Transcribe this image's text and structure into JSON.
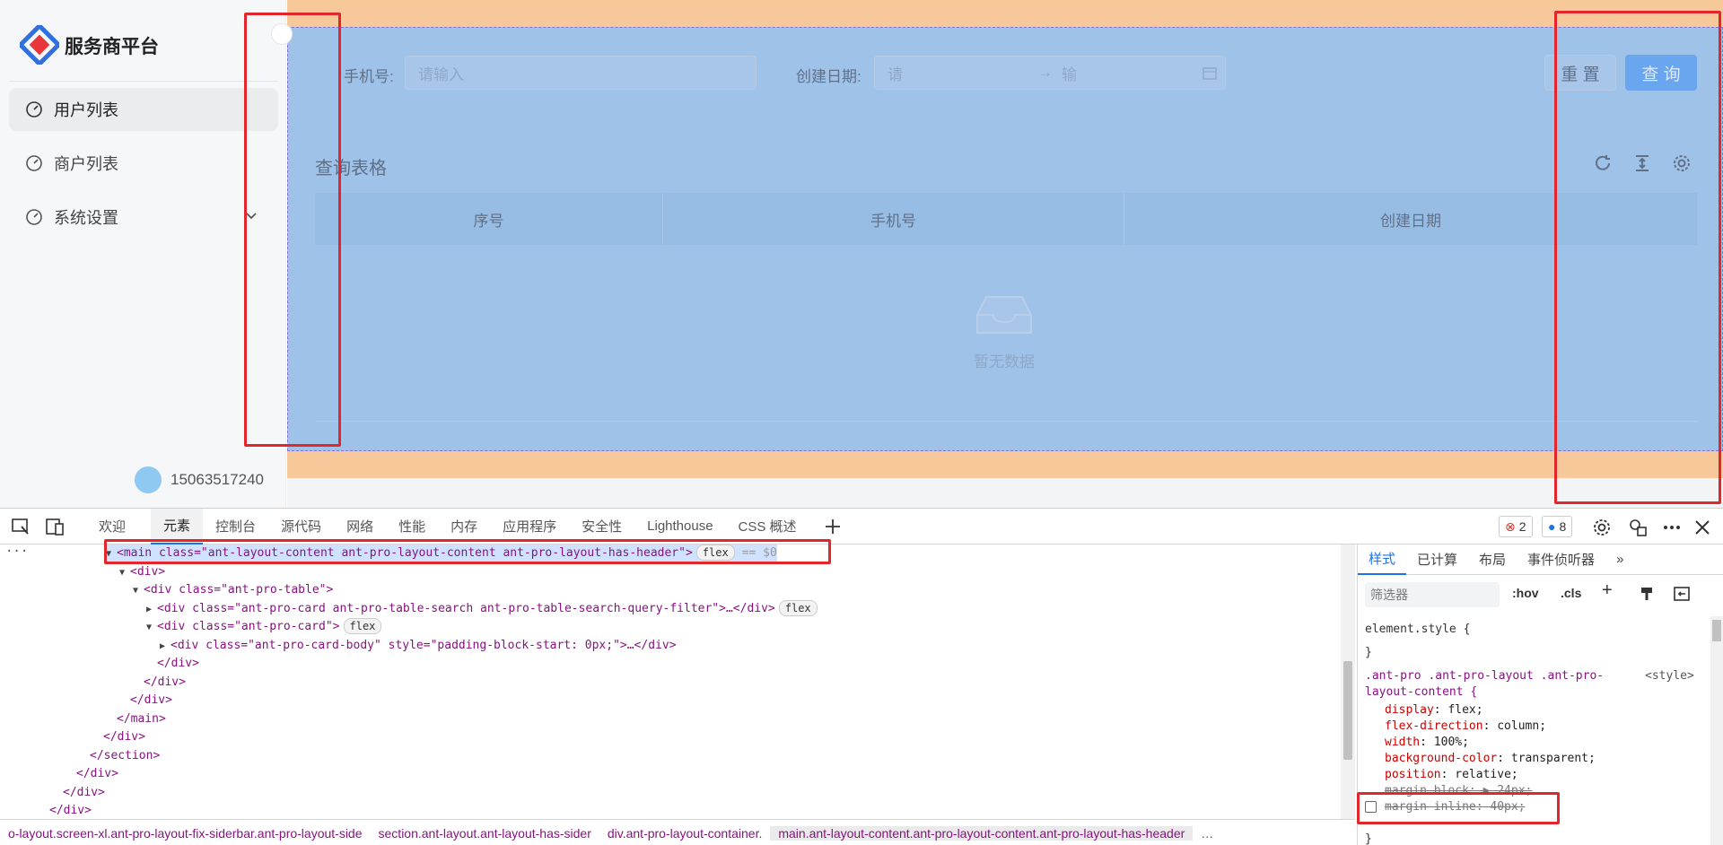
{
  "sidebar": {
    "brand": "服务商平台",
    "items": [
      {
        "label": "用户列表"
      },
      {
        "label": "商户列表"
      },
      {
        "label": "系统设置"
      }
    ],
    "user_phone": "15063517240"
  },
  "search": {
    "phone_label": "手机号:",
    "phone_placeholder": "请输入",
    "date_label": "创建日期:",
    "date_start": "请",
    "date_arrow": "→",
    "date_end": "输",
    "reset_label": "重 置",
    "query_label": "查 询"
  },
  "table": {
    "title": "查询表格",
    "columns": [
      "序号",
      "手机号",
      "创建日期"
    ],
    "empty": "暂无数据"
  },
  "devtools": {
    "tabs": [
      "欢迎",
      "元素",
      "控制台",
      "源代码",
      "网络",
      "性能",
      "内存",
      "应用程序",
      "安全性",
      "Lighthouse",
      "CSS 概述"
    ],
    "errors": "2",
    "messages": "8",
    "styles_tabs": [
      "样式",
      "已计算",
      "布局",
      "事件侦听器"
    ],
    "filter_placeholder": "筛选器",
    "hov": ":hov",
    "cls": ".cls",
    "element_style": "element.style {",
    "close_brace": "}",
    "rule_selector": ".ant-pro .ant-pro-layout .ant-pro-",
    "rule_selector2": "layout-content {",
    "rule_source": "<style>",
    "props": [
      {
        "name": "display",
        "value": "flex;"
      },
      {
        "name": "flex-direction",
        "value": "column;"
      },
      {
        "name": "width",
        "value": "100%;"
      },
      {
        "name": "background-color",
        "value": "transparent;"
      },
      {
        "name": "position",
        "value": "relative;"
      },
      {
        "name": "margin-block",
        "value": "▶ 24px;"
      },
      {
        "name": "margin-inline",
        "value": "40px;"
      }
    ],
    "dom_lines": [
      {
        "indent": 1,
        "text": "<main class=\"ant-layout-content ant-pro-layout-content ant-pro-layout-has-header\">"
      },
      {
        "indent": 2,
        "text": "<div>"
      },
      {
        "indent": 3,
        "text": "<div class=\"ant-pro-table\">"
      },
      {
        "indent": 4,
        "text": "<div class=\"ant-pro-card ant-pro-table-search ant-pro-table-search-query-filter\">…</div>"
      },
      {
        "indent": 4,
        "text": "<div class=\"ant-pro-card\">"
      },
      {
        "indent": 5,
        "text": "<div class=\"ant-pro-card-body\" style=\"padding-block-start: 0px;\">…</div>"
      },
      {
        "indent": 4,
        "text": "</div>"
      },
      {
        "indent": 3,
        "text": "</div>"
      },
      {
        "indent": 2,
        "text": "</div>"
      },
      {
        "indent": 1,
        "text": "</main>"
      },
      {
        "indent": 0,
        "text": "</div>"
      },
      {
        "indent": -1,
        "text": "</section>"
      },
      {
        "indent": -2,
        "text": "</div>"
      },
      {
        "indent": -3,
        "text": "</div>"
      },
      {
        "indent": -4,
        "text": "</div>"
      }
    ],
    "flex_badge": "flex",
    "dollar0": "== $0",
    "breadcrumbs": [
      "o-layout.screen-xl.ant-pro-layout-fix-siderbar.ant-pro-layout-side",
      "section.ant-layout.ant-layout-has-sider",
      "div.ant-pro-layout-container.",
      "main.ant-layout-content.ant-pro-layout-content.ant-pro-layout-has-header"
    ],
    "more": "…"
  }
}
